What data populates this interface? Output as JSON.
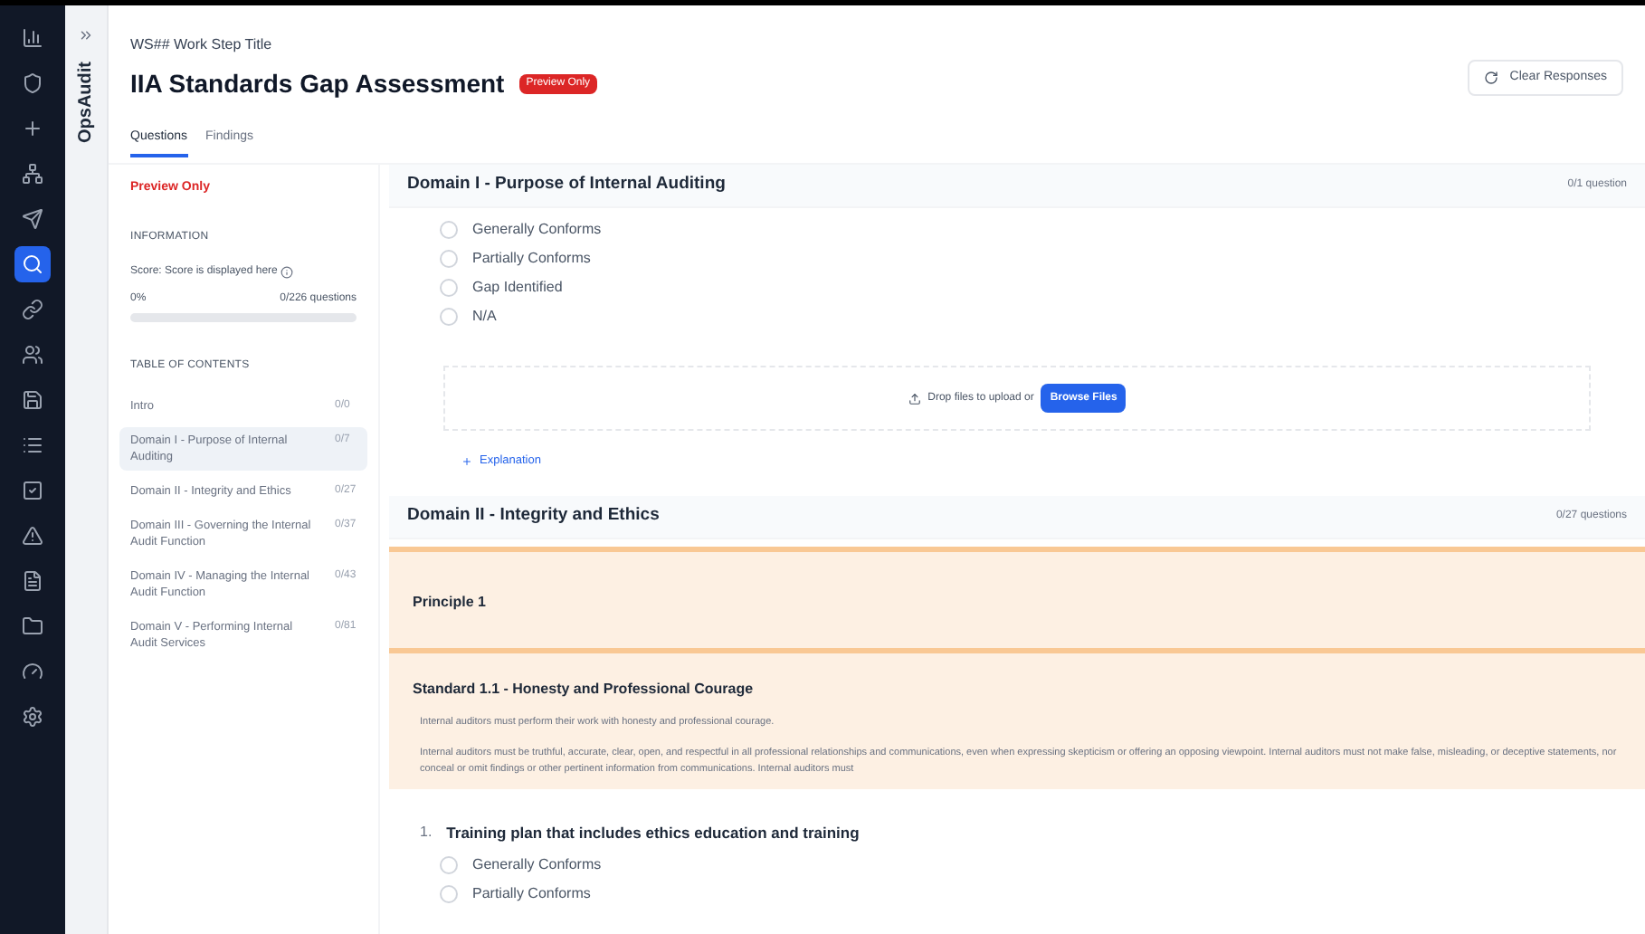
{
  "nav": {
    "items": [
      {
        "selected": false
      },
      {
        "selected": false
      },
      {
        "selected": false
      },
      {
        "selected": false
      },
      {
        "selected": false
      },
      {
        "selected": true
      },
      {
        "selected": false
      },
      {
        "selected": false
      },
      {
        "selected": false
      },
      {
        "selected": false
      },
      {
        "selected": false
      },
      {
        "selected": false
      },
      {
        "selected": false
      },
      {
        "selected": false
      },
      {
        "selected": false
      },
      {
        "selected": false
      }
    ]
  },
  "app_name": "OpsAudit",
  "header": {
    "subtitle": "WS## Work Step Title",
    "title": "IIA Standards Gap Assessment",
    "badge": "Preview Only",
    "clear_button": "Clear Responses"
  },
  "tabs": [
    {
      "label": "Questions",
      "selected": true
    },
    {
      "label": "Findings",
      "selected": false
    }
  ],
  "sidebar": {
    "notice": "Preview Only",
    "info_heading": "INFORMATION",
    "score_label": "Score: Score is displayed here",
    "percent": "0%",
    "questions": "0/226 questions",
    "toc_heading": "TABLE OF CONTENTS",
    "items": [
      {
        "label": "Intro",
        "count": "0/0",
        "selected": false
      },
      {
        "label": "Domain I - Purpose of Internal Auditing",
        "count": "0/7",
        "selected": true
      },
      {
        "label": "Domain II - Integrity and Ethics",
        "count": "0/27",
        "selected": false
      },
      {
        "label": "Domain III - Governing the Internal Audit Function",
        "count": "0/37",
        "selected": false
      },
      {
        "label": "Domain IV - Managing the Internal Audit Function",
        "count": "0/43",
        "selected": false
      },
      {
        "label": "Domain V - Performing Internal Audit Services",
        "count": "0/81",
        "selected": false
      }
    ]
  },
  "domain_1": {
    "title": "Domain I - Purpose of Internal Auditing",
    "count": "0/1 question",
    "options": [
      {
        "label": "Generally Conforms",
        "selected": false
      },
      {
        "label": "Partially Conforms",
        "selected": false
      },
      {
        "label": "Gap Identified",
        "selected": false
      },
      {
        "label": "N/A",
        "selected": false
      }
    ],
    "upload_text": "Drop files to upload or",
    "browse_button": "Browse Files",
    "explanation": "Explanation"
  },
  "domain_2": {
    "title": "Domain II - Integrity and Ethics",
    "count": "0/27 questions",
    "principle": "Principle 1",
    "standard": "Standard 1.1 - Honesty and Professional Courage",
    "paragraphs": [
      "Internal auditors must perform their work with honesty and professional courage.",
      "Internal auditors must be truthful, accurate, clear, open, and respectful in all professional relationships and communications, even when expressing skepticism or offering an opposing viewpoint. Internal auditors must not make false, misleading, or deceptive statements, nor conceal or omit findings or other pertinent information from communications. Internal auditors must"
    ],
    "question_number": "1.",
    "question": "Training plan that includes ethics education and training",
    "options": [
      {
        "label": "Generally Conforms",
        "selected": false
      },
      {
        "label": "Partially Conforms",
        "selected": false
      }
    ]
  }
}
